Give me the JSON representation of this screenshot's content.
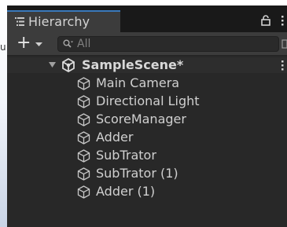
{
  "window": {
    "tab_title": "Hierarchy"
  },
  "toolbar": {
    "add_label": "+",
    "search_placeholder": "All"
  },
  "scene": {
    "name": "SampleScene*",
    "objects": [
      {
        "label": "Main Camera"
      },
      {
        "label": "Directional Light"
      },
      {
        "label": "ScoreManager"
      },
      {
        "label": "Adder"
      },
      {
        "label": "SubTrator"
      },
      {
        "label": "SubTrator (1)"
      },
      {
        "label": "Adder (1)"
      }
    ]
  },
  "icons": {
    "tab": "hierarchy-list-icon",
    "lock": "lock-icon",
    "menu": "kebab-menu-icon",
    "add_dropdown": "chevron-down-icon",
    "search": "search-icon",
    "scene": "unity-scene-icon",
    "game_object": "cube-icon"
  },
  "colors": {
    "panel_bg": "#282828",
    "tab_bg": "#3c3c3c",
    "tab_accent": "#3a79bb",
    "text": "#d2d2d2"
  }
}
